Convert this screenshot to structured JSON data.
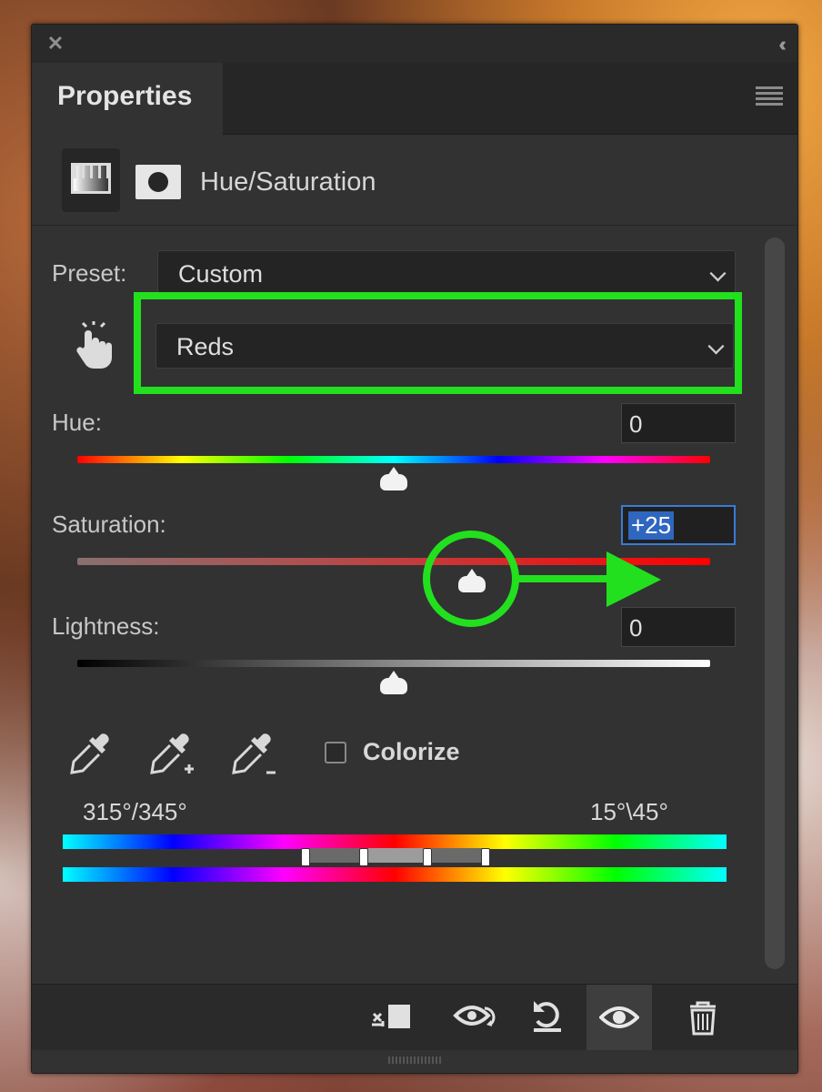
{
  "panel": {
    "tab_label": "Properties",
    "adjustment_title": "Hue/Saturation"
  },
  "preset": {
    "label": "Preset:",
    "value": "Custom"
  },
  "channel": {
    "value": "Reds"
  },
  "hue": {
    "label": "Hue:",
    "value": "0",
    "level": 0.5
  },
  "saturation": {
    "label": "Saturation:",
    "value": "+25",
    "level": 0.625
  },
  "lightness": {
    "label": "Lightness:",
    "value": "0",
    "level": 0.5
  },
  "colorize": {
    "label": "Colorize",
    "checked": false
  },
  "range": {
    "left": "315°/345°",
    "right": "15°\\45°"
  },
  "icons": {
    "close": "close-icon",
    "collapse": "double-chevron-icon",
    "menu": "panel-menu-icon",
    "targeted_adjustment": "hand-pointer-icon",
    "eyedropper": "eyedropper-icon",
    "eyedropper_add": "eyedropper-plus-icon",
    "eyedropper_subtract": "eyedropper-minus-icon",
    "clip": "clip-to-layer-icon",
    "view_previous": "view-previous-state-icon",
    "reset": "reset-icon",
    "visibility": "eye-icon",
    "delete": "trash-icon"
  },
  "colors": {
    "annotation": "#22e01e",
    "selection": "#2f67c0",
    "panel_bg": "#323232"
  }
}
